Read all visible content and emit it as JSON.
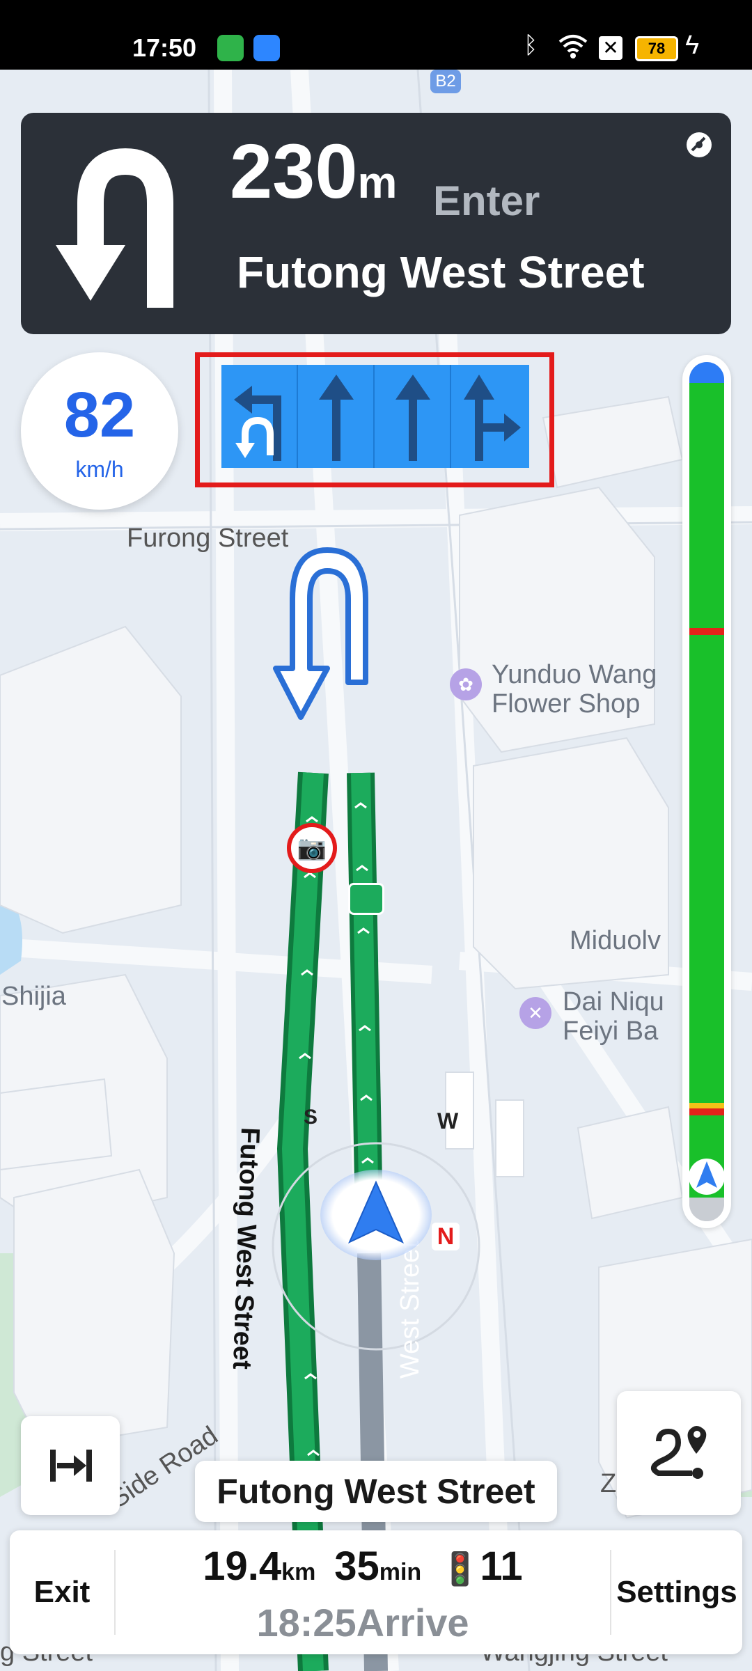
{
  "status_bar": {
    "time": "17:50",
    "icons": [
      "shield-icon",
      "weather-icon",
      "bluetooth-icon",
      "wifi-icon",
      "no-sim-icon",
      "battery-icon",
      "charging-icon"
    ],
    "battery": "78"
  },
  "map": {
    "labels": {
      "b2": "B2",
      "furong_street": "Furong Street",
      "yunduo": "Yunduo Wang",
      "flower_shop": "Flower Shop",
      "miduolv": "Miduolv",
      "dai_niqu": "Dai Niqu",
      "feiyi_ba": "Feiyi Ba",
      "shijia": "Shijia",
      "side_road": "Side Road",
      "route_label_left": "Futong West Street",
      "route_label_right": "West Street",
      "z_label": "Z",
      "bottom_street_left": "g Street",
      "bottom_street_right": "Wangjing Street",
      "compass_w": "W",
      "compass_n": "N",
      "compass_s": "S"
    }
  },
  "banner": {
    "distance": "230",
    "unit": "m",
    "action": "Enter",
    "street": "Futong West Street",
    "maneuver_icon": "u-turn-icon"
  },
  "speed": {
    "value": "82",
    "unit": "km/h"
  },
  "lanes": [
    {
      "icon": "u-turn-lane-icon",
      "recommended": true
    },
    {
      "icon": "straight-lane-icon",
      "recommended": false
    },
    {
      "icon": "straight-lane-icon",
      "recommended": false
    },
    {
      "icon": "straight-right-lane-icon",
      "recommended": false
    }
  ],
  "traffic_bar": {
    "colors": {
      "clear": "#19c02a",
      "congested": "#e2231a",
      "slow": "#f2c318",
      "start": "#2d7cf5"
    }
  },
  "road_pill": "Futong West Street",
  "bottom": {
    "exit": "Exit",
    "distance": "19.4",
    "distance_unit": "km",
    "time": "35",
    "time_unit": "min",
    "traffic_lights": "11",
    "arrive_time": "18:25",
    "arrive_label": "Arrive",
    "settings": "Settings"
  },
  "colors": {
    "banner_bg": "#2b3038",
    "route": "#1cab5c",
    "lane_bg": "#2d96f5",
    "highlight": "#e31b1b",
    "speed_text": "#2464e8"
  }
}
